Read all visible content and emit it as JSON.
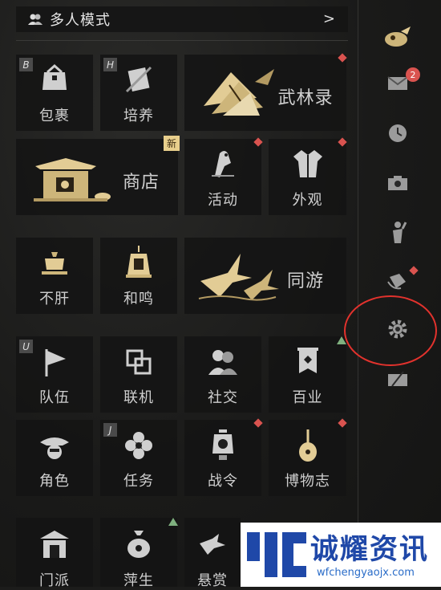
{
  "header": {
    "title": "多人模式",
    "chevron": ">"
  },
  "tiles": {
    "bag": {
      "label": "包裹",
      "key": "B"
    },
    "train": {
      "label": "培养",
      "key": "H"
    },
    "wulinlu": {
      "label": "武林录"
    },
    "shop": {
      "label": "商店",
      "badge": "新"
    },
    "activity": {
      "label": "活动"
    },
    "appearance": {
      "label": "外观"
    },
    "buqian": {
      "label": "不肝"
    },
    "hemin": {
      "label": "和鸣"
    },
    "tongyou": {
      "label": "同游"
    },
    "team": {
      "label": "队伍",
      "key": "U"
    },
    "online": {
      "label": "联机"
    },
    "social": {
      "label": "社交"
    },
    "baiye": {
      "label": "百业"
    },
    "character": {
      "label": "角色"
    },
    "quest": {
      "label": "任务",
      "key": "J"
    },
    "battlepass": {
      "label": "战令"
    },
    "museum": {
      "label": "博物志"
    },
    "row6a": {
      "label": "门派"
    },
    "row6b": {
      "label": "萍生"
    },
    "row6c": {
      "label": "悬赏"
    }
  },
  "side": {
    "mail_count": "2"
  },
  "watermark": {
    "brand": "诚耀资讯",
    "url": "wfchengyaojx.com"
  },
  "colors": {
    "accent_gold": "#e8cf8c",
    "alert_red": "#d9534f",
    "highlight_circle": "#e2322d"
  }
}
